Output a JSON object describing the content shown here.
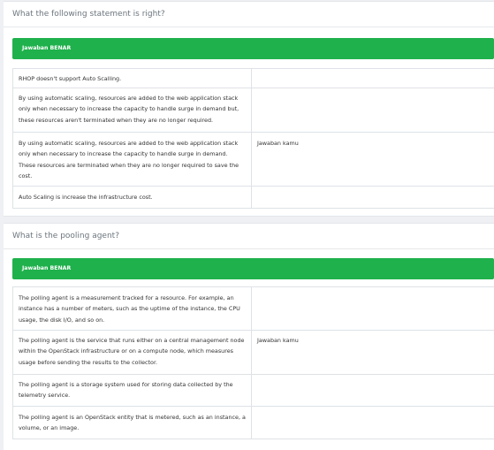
{
  "questions": [
    {
      "text": "What the following statement is right?",
      "banner": "Jawaban BENAR",
      "options": [
        {
          "text": "RHOP doesn't support Auto Scalling.",
          "mark": ""
        },
        {
          "text": "By using automatic scaling, resources are added to the web application stack only when necessary to increase the capacity to handle surge in demand but, these resources aren't terminated when they are no longer required.",
          "mark": ""
        },
        {
          "text": "By using automatic scaling, resources are added to the web application stack only when necessary to increase the capacity to handle surge in demand. These resources are terminated when they are no longer required to save the cost.",
          "mark": "Jawaban kamu"
        },
        {
          "text": "Auto Scaling is increase the infrastructure cost.",
          "mark": ""
        }
      ]
    },
    {
      "text": "What is the pooling agent?",
      "banner": "Jawaban BENAR",
      "options": [
        {
          "text": "The polling agent is a measurement tracked for a resource. For example, an instance has a number of meters, such as the uptime of the instance, the CPU usage, the disk I/O, and so on.",
          "mark": ""
        },
        {
          "text": "The polling agent is the service that runs either on a central management node within the OpenStack infrastructure or on a compute node, which measures usage before sending the results to the collector.",
          "mark": "Jawaban kamu"
        },
        {
          "text": "The polling agent is a storage system used for storing data collected by the telemetry service.",
          "mark": ""
        },
        {
          "text": "The polling agent is an OpenStack entity that is metered, such as an instance, a volume, or an image.",
          "mark": ""
        }
      ]
    }
  ]
}
